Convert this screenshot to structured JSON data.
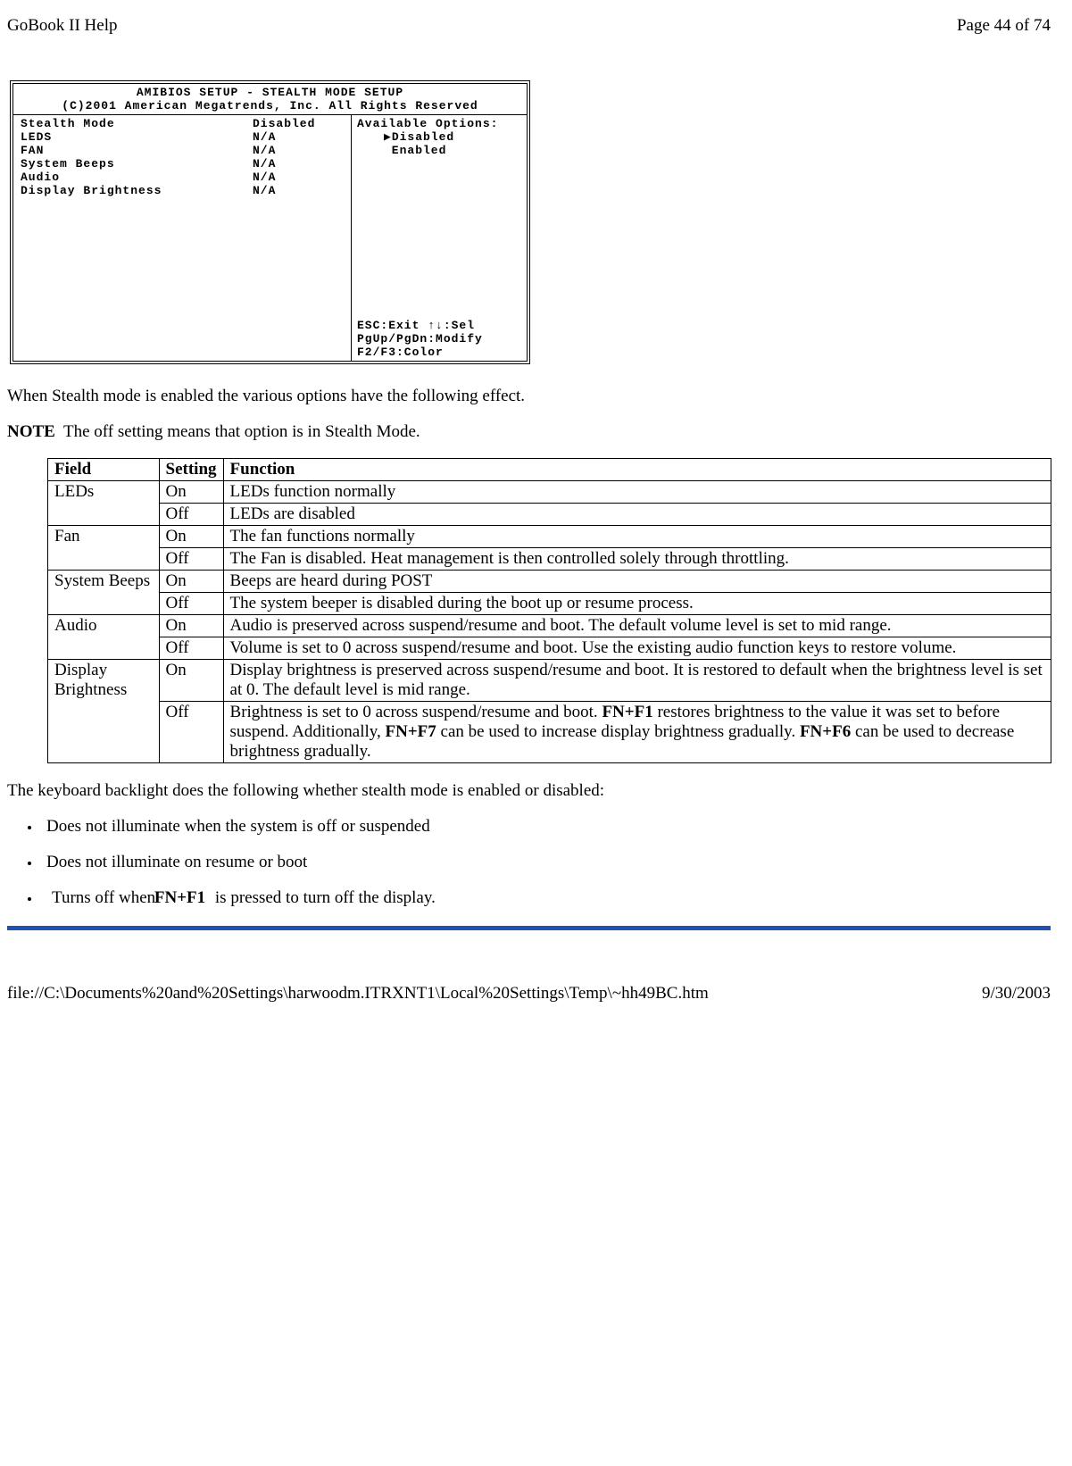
{
  "header": {
    "title": "GoBook II Help",
    "page": "Page 44 of 74"
  },
  "bios": {
    "title1": "AMIBIOS SETUP - STEALTH MODE SETUP",
    "title2": "(C)2001 American Megatrends, Inc. All Rights Reserved",
    "rows": [
      {
        "label": "Stealth Mode",
        "value": "Disabled"
      },
      {
        "label": "LEDS",
        "value": "N/A"
      },
      {
        "label": "FAN",
        "value": "N/A"
      },
      {
        "label": "System Beeps",
        "value": "N/A"
      },
      {
        "label": "Audio",
        "value": "N/A"
      },
      {
        "label": "Display Brightness",
        "value": "N/A"
      }
    ],
    "options_title": "Available Options:",
    "opt1": "▶Disabled",
    "opt2": " Enabled",
    "footer1": "ESC:Exit ↑↓:Sel",
    "footer2": "PgUp/PgDn:Modify",
    "footer3": "F2/F3:Color"
  },
  "text": {
    "p1": "When Stealth mode is enabled the various options have the following effect.",
    "note_label": "NOTE",
    "note_text": "  The off setting means that option is in Stealth Mode.",
    "p2": "The keyboard backlight does the following whether stealth mode is enabled or disabled:",
    "li1": "Does not illuminate when the system is off or suspended",
    "li2": "Does not illuminate on resume or boot",
    "li3a": "Turns off when ",
    "li3b": "FN+F1",
    "li3c": " is pressed to turn off the display."
  },
  "table": {
    "h1": "Field",
    "h2": "Setting",
    "h3": "Function",
    "r1c1": "LEDs",
    "r1c2": "On",
    "r1c3": "LEDs function normally",
    "r2c2": "Off",
    "r2c3": "LEDs are disabled",
    "r3c1": "Fan",
    "r3c2": "On",
    "r3c3": "The fan functions normally",
    "r4c2": "Off",
    "r4c3": "The Fan is disabled.  Heat management is then controlled solely through throttling.",
    "r5c1": "System Beeps",
    "r5c2": "On",
    "r5c3": "Beeps are heard during POST",
    "r6c2": "Off",
    "r6c3": "The system beeper is disabled during the boot up or resume process.",
    "r7c1": "Audio",
    "r7c2": "On",
    "r7c3": "Audio is preserved across suspend/resume and boot.  The default volume level is set to mid range.",
    "r8c2": "Off",
    "r8c3": "Volume is set to 0 across suspend/resume and boot.  Use the existing audio function keys to restore volume.",
    "r9c1": "Display Brightness",
    "r9c2": "On",
    "r9c3": "Display brightness is preserved across suspend/resume and boot.  It is restored to default when the brightness level is set at 0.  The default level is mid range.",
    "r10c2": "Off",
    "r10c3a": "Brightness is set to 0 across suspend/resume and boot.  ",
    "r10c3b": "FN+F1",
    "r10c3c": " restores brightness to the value it was set to before suspend.  Additionally, ",
    "r10c3d": "FN+F7",
    "r10c3e": " can be used to increase display brightness gradually.  ",
    "r10c3f": "FN+F6",
    "r10c3g": " can be used to decrease brightness gradually."
  },
  "footer": {
    "path": "file://C:\\Documents%20and%20Settings\\harwoodm.ITRXNT1\\Local%20Settings\\Temp\\~hh49BC.htm",
    "date": "9/30/2003"
  }
}
